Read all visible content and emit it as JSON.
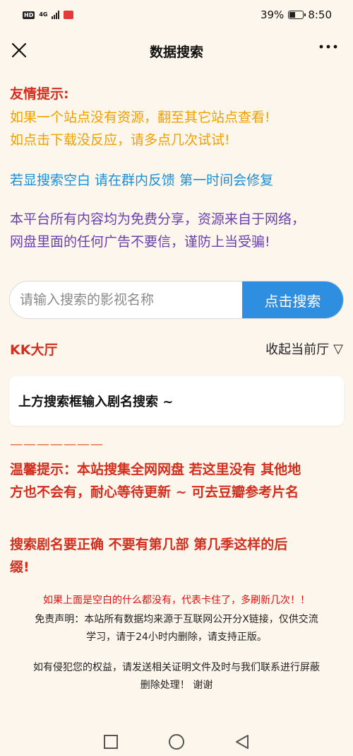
{
  "status_bar": {
    "hd": "HD",
    "network": "4G",
    "battery_percent": "39%",
    "battery_level": 0.39,
    "time": "8:50"
  },
  "nav": {
    "title": "数据搜索"
  },
  "notice": {
    "heading": "友情提示:",
    "line1": "如果一个站点没有资源，翻至其它站点查看!",
    "line2": "如点击下载没反应，请多点几次试试!",
    "blue_line": "若显搜索空白 请在群内反馈 第一时间会修复",
    "purple_line1": "本平台所有内容均为免费分享，资源来自于网络，",
    "purple_line2": "网盘里面的任何广告不要信，谨防上当受骗!"
  },
  "search": {
    "placeholder": "请输入搜索的影视名称",
    "button_label": "点击搜索"
  },
  "hall": {
    "title": "KK大厅",
    "collapse_label": "收起当前厅",
    "collapse_arrow": "▽"
  },
  "result_card": {
    "text": "上方搜索框输入剧名搜索 ~"
  },
  "divider": "———————",
  "warm_tip": {
    "line1": "温馨提示：本站搜集全网网盘 若这里没有 其他地",
    "line2": "方也不会有，耐心等待更新 ~ 可去豆瓣参考片名"
  },
  "name_tip": {
    "line1": "搜索剧名要正确 不要有第几部 第几季这样的后",
    "line2": "缀!"
  },
  "refresh_note": "如果上面是空白的什么都没有，代表卡住了，多刷新几次！！",
  "disclaimer": {
    "line1": "免责声明：本站所有数据均来源于互联网公开分X链接，仅供交流",
    "line2": "学习，请于24小时内删除，请支持正版。"
  },
  "infringe": {
    "line1": "如有侵犯您的权益，请发送相关证明文件及时与我们联系进行屏蔽",
    "line2": "删除处理！ 谢谢"
  },
  "colors": {
    "red": "#d32f1f",
    "orange": "#f0a000",
    "blue": "#1a8fd8",
    "purple": "#6a3fb0",
    "button": "#2e8fe0"
  }
}
